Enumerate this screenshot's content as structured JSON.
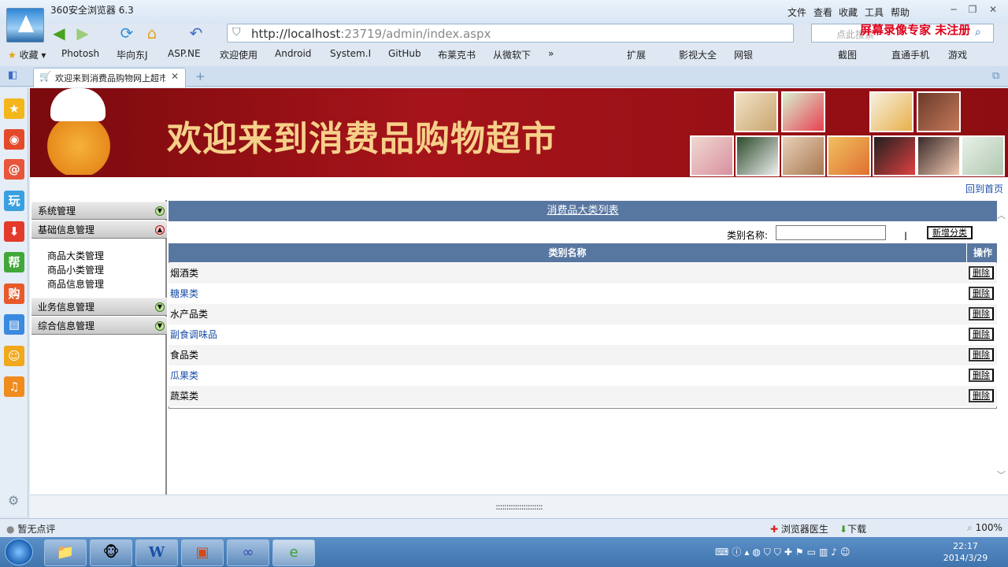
{
  "browser": {
    "app_title": "360安全浏览器 6.3",
    "menu": [
      "文件",
      "查看",
      "收藏",
      "工具",
      "帮助"
    ],
    "url_host": "http://localhost",
    "url_rest": ":23719/admin/index.aspx",
    "search_placeholder": "点此搜索",
    "watermark": "屏幕录像专家  未注册",
    "bookmarks": [
      "收藏",
      "Photosh",
      "毕向东J",
      "ASP.NE",
      "欢迎使用",
      "Android",
      "System.I",
      "GitHub",
      "布莱克书",
      "从微软下",
      "»"
    ],
    "toolbar_right": [
      "扩展",
      "影视大全",
      "网银",
      "截图",
      "直通手机",
      "游戏"
    ],
    "tab_title": "欢迎来到消费品购物网上超市"
  },
  "page": {
    "banner_text": "欢迎来到消费品购物超市",
    "home_link": "回到首页",
    "menu": {
      "sections": [
        {
          "label": "系统管理"
        },
        {
          "label": "基础信息管理"
        },
        {
          "label": "业务信息管理"
        },
        {
          "label": "综合信息管理"
        }
      ],
      "sub_items": [
        "商品大类管理",
        "商品小类管理",
        "商品信息管理"
      ]
    },
    "list_title": "消费品大类列表",
    "search_label": "类别名称:",
    "add_button": "新增分类",
    "table": {
      "col_name": "类别名称",
      "col_action": "操作",
      "delete_label": "删除",
      "rows": [
        "烟酒类",
        "糖果类",
        "水产品类",
        "副食调味品",
        "食品类",
        "瓜果类",
        "蔬菜类"
      ]
    },
    "splitter": "::::::::::::::::::::::"
  },
  "status": {
    "left": "暂无点评",
    "doctor": "浏览器医生",
    "download": "下载",
    "zoom": "100%"
  },
  "taskbar": {
    "time": "22:17",
    "date": "2014/3/29"
  },
  "colors": {
    "header_blue": "#5877a0",
    "banner_red": "#a5141a",
    "banner_text": "#f6d08a",
    "link_blue": "#1a4fa8"
  }
}
